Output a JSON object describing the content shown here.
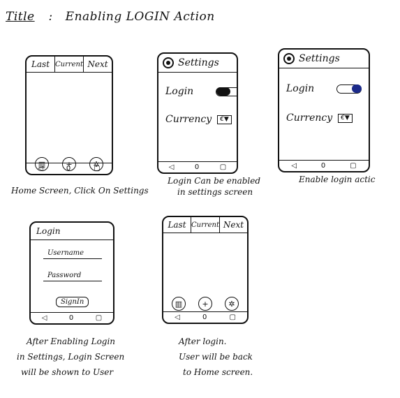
{
  "title": {
    "label": "Title",
    "sep": ":",
    "text": "Enabling LOGIN Action"
  },
  "home": {
    "tabs": [
      "Last",
      "Current",
      "Next"
    ],
    "icons": [
      "bank-icon",
      "plus-icon",
      "gear-icon"
    ]
  },
  "nav": {
    "back": "◁",
    "home": "0",
    "recent": "▢"
  },
  "settings": {
    "title": "Settings",
    "login_label": "Login",
    "currency_label": "Currency",
    "currency_value": "€▼"
  },
  "login_screen": {
    "title": "Login",
    "username": "Username",
    "password": "Password",
    "signin": "SignIn"
  },
  "captions": {
    "c1": "Home Screen, Click On Settings",
    "c2a": "Login Can be enabled",
    "c2b": "in settings screen",
    "c3": "Enable login actic",
    "c4a": "After Enabling Login",
    "c4b": "in Settings, Login Screen",
    "c4c": "will be shown to User",
    "c5a": "After login.",
    "c5b": "User will be back",
    "c5c": "to Home screen."
  }
}
